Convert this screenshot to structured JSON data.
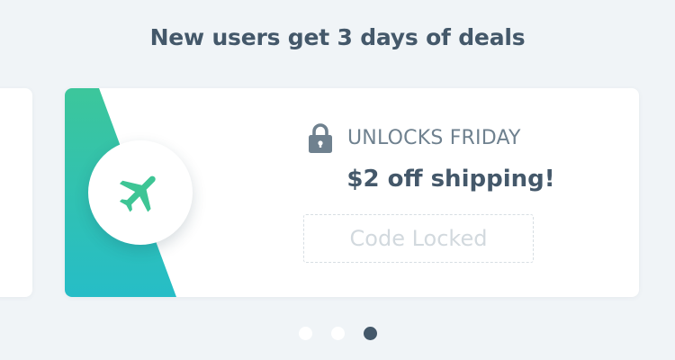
{
  "header": {
    "title": "New users get 3 days of deals"
  },
  "carousel": {
    "active_index": 2,
    "dot_count": 3,
    "card": {
      "icon": "airplane-icon",
      "status_icon": "lock-icon",
      "status": "UNLOCKS FRIDAY",
      "offer": "$2 off shipping!",
      "code_label": "Code Locked"
    }
  },
  "colors": {
    "accent_top": "#3cc69b",
    "accent_bottom": "#26bdc7",
    "heading": "#44586a",
    "muted": "#6f818f",
    "locked": "#d2d9de"
  }
}
